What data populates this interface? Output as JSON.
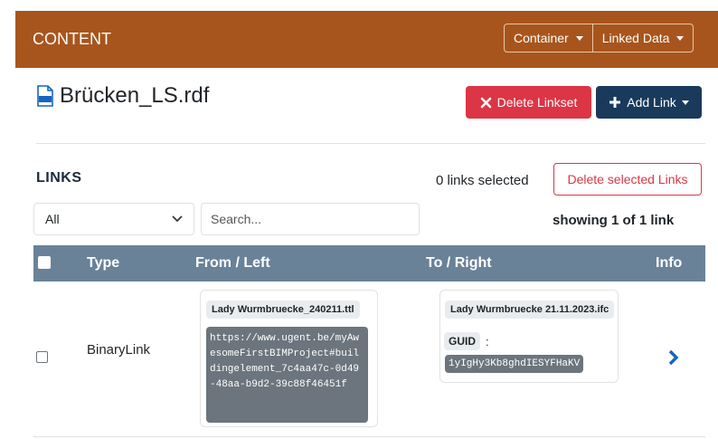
{
  "header": {
    "title": "CONTENT",
    "container_label": "Container",
    "linked_data_label": "Linked Data"
  },
  "file": {
    "icon": "pdf-file-icon",
    "name": "Brücken_LS.rdf"
  },
  "actions": {
    "delete_linkset": "Delete Linkset",
    "add_link": "Add Link"
  },
  "links": {
    "heading": "LINKS",
    "selected_text": "0 links selected",
    "delete_selected": "Delete selected Links",
    "filter_value": "All",
    "search_placeholder": "Search...",
    "showing_text": "showing 1 of 1 link"
  },
  "table": {
    "columns": [
      "Type",
      "From / Left",
      "To / Right",
      "Info"
    ],
    "rows": [
      {
        "type": "BinaryLink",
        "from": {
          "document": "Lady Wurmbruecke_240211.ttl",
          "uri": "https://www.ugent.be/myAwesomeFirstBIMProject#buildingelement_7c4aa47c-0d49-48aa-b9d2-39c88f46451f"
        },
        "to": {
          "document": "Lady Wurmbruecke 21.11.2023.ifc",
          "key": "GUID",
          "separator": ":",
          "value": "1yIgHy3Kb8ghdIESYFHaKV"
        }
      }
    ]
  },
  "colors": {
    "header_bg": "#a8551d",
    "danger": "#dc3545",
    "primary_dark": "#1a3a5c",
    "table_head": "#6a8298",
    "link_blue": "#1565c0"
  }
}
